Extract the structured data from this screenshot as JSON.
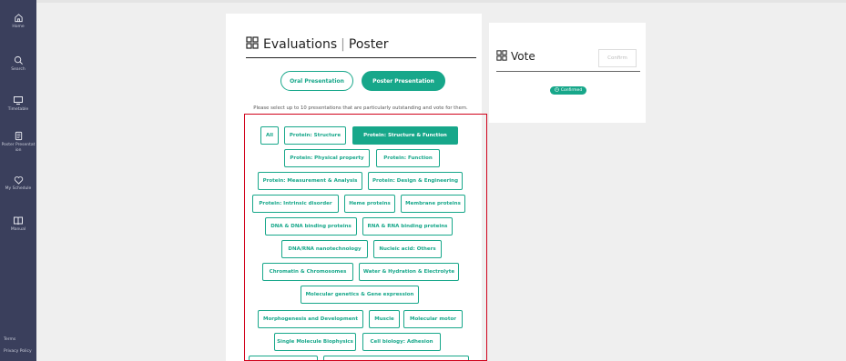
{
  "sidebar": {
    "items": [
      {
        "label": "Home",
        "icon": "home-icon"
      },
      {
        "label": "Search",
        "icon": "search-icon"
      },
      {
        "label": "Timetable",
        "icon": "monitor-icon"
      },
      {
        "label": "Poster Presentat ion",
        "icon": "document-icon"
      },
      {
        "label": "My Schedule",
        "icon": "heart-icon"
      },
      {
        "label": "Manual",
        "icon": "book-icon"
      }
    ],
    "footer": {
      "terms": "Terms",
      "privacy": "Privacy Policy"
    }
  },
  "evaluations": {
    "title_main": "Evaluations",
    "title_sub": "Poster",
    "oral_label": "Oral Presentation",
    "poster_label": "Poster Presentation",
    "instruction": "Please select up to 10 presentations that are particularly outstanding and vote for them.",
    "filters": [
      "All",
      "Protein: Structure",
      "Protein: Structure & Function",
      "Protein: Physical property",
      "Protein: Function",
      "Protein: Measurement & Analysis",
      "Protein: Design & Engineering",
      "Protein: Intrinsic disorder",
      "Heme proteins",
      "Membrane proteins",
      "DNA & DNA binding proteins",
      "RNA & RNA binding proteins",
      "DNA/RNA nanotechnology",
      "Nucleic acid: Others",
      "Chromatin & Chromosomes",
      "Water & Hydration & Electrolyte",
      "Molecular genetics & Gene expression",
      "Morphogenesis and Development",
      "Muscle",
      "Molecular motor",
      "Single Molecule Biophysics",
      "Cell biology: Adhesion"
    ],
    "active_filter": "Protein: Structure & Function"
  },
  "vote": {
    "title": "Vote",
    "confirm_label": "Confirm",
    "status_label": "Confirmed"
  },
  "colors": {
    "accent": "#17a78a",
    "sidebar": "#3a3f5c",
    "highlight_border": "#d0021b"
  }
}
